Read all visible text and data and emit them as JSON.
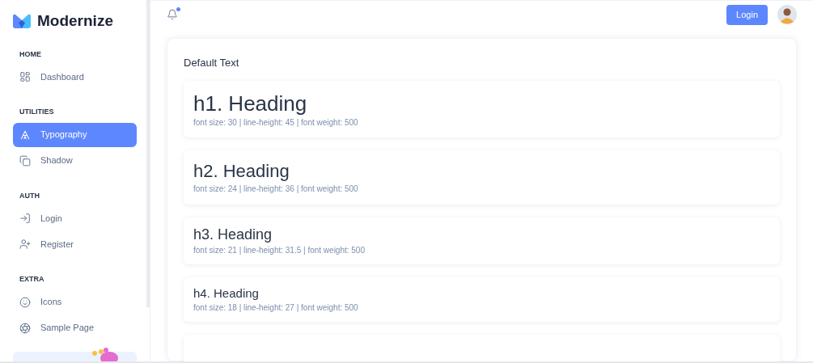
{
  "brand": {
    "name": "Modernize"
  },
  "sidebar": {
    "sections": [
      {
        "title": "HOME",
        "items": [
          {
            "label": "Dashboard",
            "kind": "dashboard",
            "selected": false
          }
        ]
      },
      {
        "title": "UTILITIES",
        "items": [
          {
            "label": "Typography",
            "kind": "typography",
            "selected": true
          },
          {
            "label": "Shadow",
            "kind": "shadow",
            "selected": false
          }
        ]
      },
      {
        "title": "AUTH",
        "items": [
          {
            "label": "Login",
            "kind": "login",
            "selected": false
          },
          {
            "label": "Register",
            "kind": "register",
            "selected": false
          }
        ]
      },
      {
        "title": "EXTRA",
        "items": [
          {
            "label": "Icons",
            "kind": "icons",
            "selected": false
          },
          {
            "label": "Sample Page",
            "kind": "sample",
            "selected": false
          }
        ]
      }
    ]
  },
  "header": {
    "notification_dot": true,
    "login_button": "Login"
  },
  "card": {
    "title": "Default Text",
    "headings": [
      {
        "kind": "h1",
        "text": "h1. Heading",
        "spec": "font size: 30 | line-height: 45 | font weight: 500"
      },
      {
        "kind": "h2",
        "text": "h2. Heading",
        "spec": "font size: 24 | line-height: 36 | font weight: 500"
      },
      {
        "kind": "h3",
        "text": "h3. Heading",
        "spec": "font size: 21 | line-height: 31.5 | font weight: 500"
      },
      {
        "kind": "h4",
        "text": "h4. Heading",
        "spec": "font size: 18 | line-height: 27 | font weight: 500"
      }
    ]
  }
}
